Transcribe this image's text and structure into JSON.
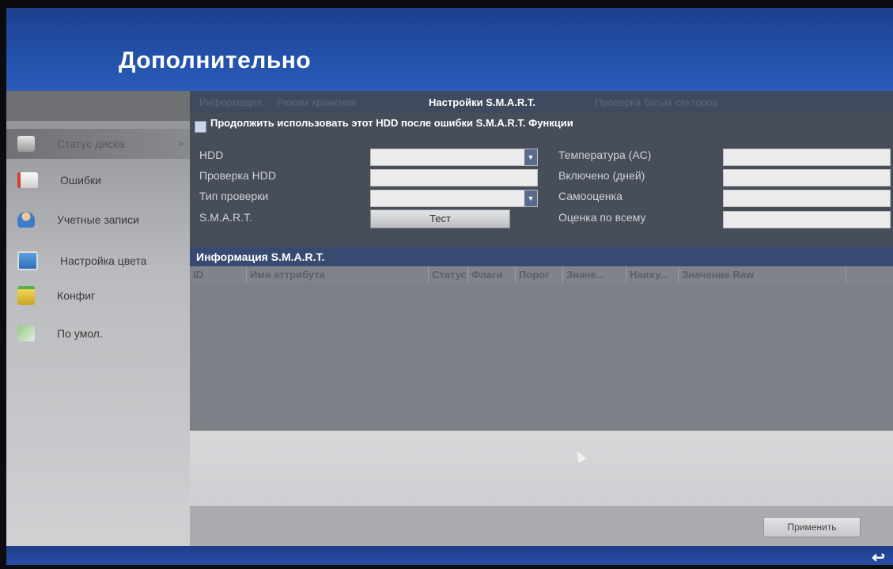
{
  "window": {
    "title": "Дополнительно"
  },
  "sidebar": {
    "items": [
      {
        "label": "Статус диска",
        "arrow": ">",
        "active": true,
        "icon": "hdd-icon"
      },
      {
        "label": "Ошибки",
        "icon": "event-list-icon"
      },
      {
        "label": "Учетные записи",
        "icon": "user-icon"
      },
      {
        "label": "Настройка цвета",
        "icon": "monitor-icon"
      },
      {
        "label": "Конфиг",
        "icon": "folder-icon"
      },
      {
        "label": "По умол.",
        "icon": "restore-icon"
      }
    ]
  },
  "tabs": [
    {
      "label": "Информация"
    },
    {
      "label": "Режим хранения"
    },
    {
      "label": "Настройки S.M.A.R.T.",
      "active": true
    },
    {
      "label": "Проверка битых секторов"
    }
  ],
  "form": {
    "checkbox_label": "Продолжить использовать этот HDD после ошибки S.M.A.R.T. Функции",
    "checkbox_checked": false,
    "hdd_label": "HDD",
    "hdd_value": "",
    "check_hdd_label": "Проверка HDD",
    "check_hdd_value": "",
    "check_type_label": "Тип проверки",
    "check_type_value": "",
    "smart_label": "S.M.A.R.T.",
    "test_button": "Тест",
    "temperature_label": "Температура (AC)",
    "temperature_value": "",
    "power_on_label": "Включено (дней)",
    "power_on_value": "",
    "self_eval_label": "Самооценка",
    "self_eval_value": "",
    "overall_label": "Оценка по всему",
    "overall_value": ""
  },
  "smart_info": {
    "header": "Информация S.M.A.R.T.",
    "columns": [
      "ID",
      "Имя аттрибута",
      "Статус",
      "Флаги",
      "Порог",
      "Значе...",
      "Наиху...",
      "Значение Raw"
    ],
    "rows": []
  },
  "actions": {
    "apply": "Применить"
  },
  "footer": {
    "back_icon": "↩"
  }
}
